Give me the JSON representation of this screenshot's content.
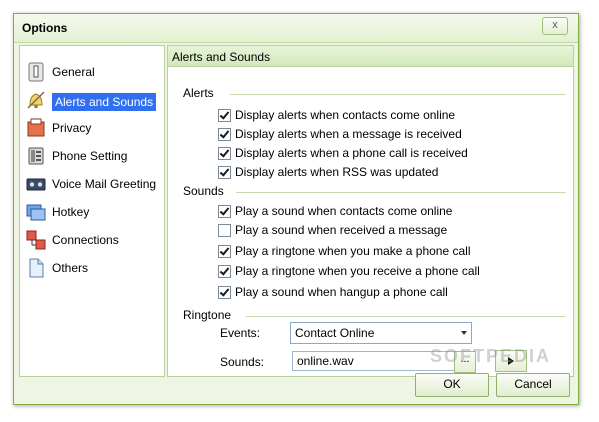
{
  "window": {
    "title": "Options",
    "close_label": "x"
  },
  "sidebar": {
    "items": [
      {
        "label": "General",
        "icon": "switch-icon"
      },
      {
        "label": "Alerts and Sounds",
        "icon": "bell-icon",
        "selected": true
      },
      {
        "label": "Privacy",
        "icon": "lock-icon"
      },
      {
        "label": "Phone Setting",
        "icon": "phone-icon"
      },
      {
        "label": "Voice Mail Greeting",
        "icon": "tape-icon"
      },
      {
        "label": "Hotkey",
        "icon": "keyboard-icon"
      },
      {
        "label": "Connections",
        "icon": "network-icon"
      },
      {
        "label": "Others",
        "icon": "document-icon"
      }
    ]
  },
  "panel": {
    "title": "Alerts and Sounds",
    "alerts": {
      "label": "Alerts",
      "options": [
        {
          "label": "Display alerts when contacts come online",
          "checked": true
        },
        {
          "label": "Display alerts when a message is received",
          "checked": true
        },
        {
          "label": "Display alerts when a phone call is received",
          "checked": true
        },
        {
          "label": "Display alerts when RSS was updated",
          "checked": true
        }
      ]
    },
    "sounds": {
      "label": "Sounds",
      "options": [
        {
          "label": "Play a sound when contacts come online",
          "checked": true
        },
        {
          "label": "Play a sound when received a message",
          "checked": false
        },
        {
          "label": "Play a ringtone when you make a phone call",
          "checked": true
        },
        {
          "label": "Play a ringtone when you receive a phone call",
          "checked": true
        },
        {
          "label": "Play a sound when hangup a phone call",
          "checked": true
        }
      ]
    },
    "ringtone": {
      "label": "Ringtone",
      "events_label": "Events:",
      "events_value": "Contact Online",
      "sounds_label": "Sounds:",
      "sounds_value": "online.wav",
      "browse_label": "..."
    }
  },
  "footer": {
    "ok_label": "OK",
    "cancel_label": "Cancel"
  },
  "watermark": "SOFTPEDIA",
  "colors": {
    "accent": "#2f6ff0",
    "window_bg": "#eef6e3",
    "border": "#7fae45"
  }
}
